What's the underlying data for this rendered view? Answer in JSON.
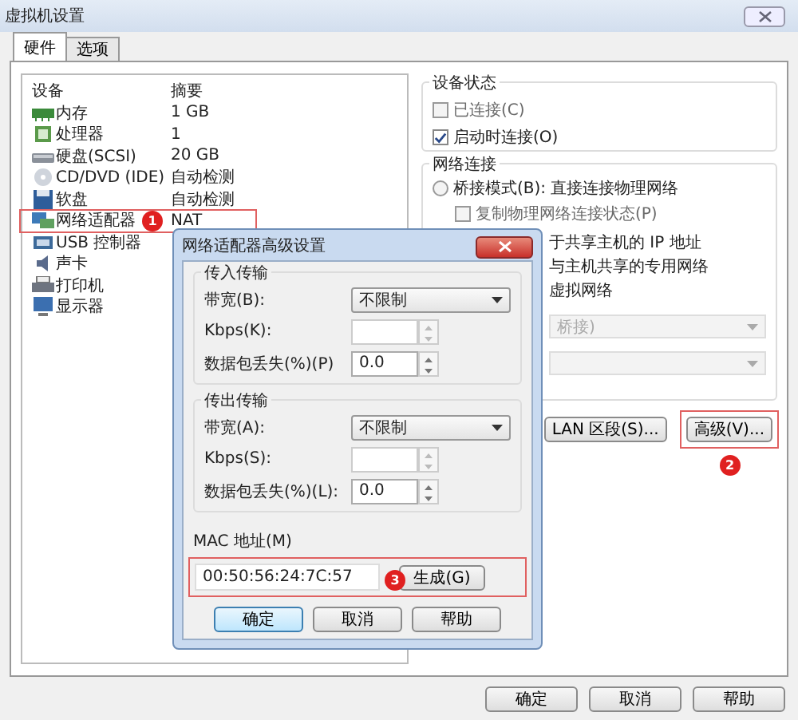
{
  "window": {
    "title": "虚拟机设置"
  },
  "tabs": [
    {
      "label": "硬件",
      "selected": true
    },
    {
      "label": "选项",
      "selected": false
    }
  ],
  "device_list": {
    "columns": [
      "设备",
      "摘要"
    ],
    "rows": [
      {
        "kind": "memory",
        "name": "内存",
        "summary": "1 GB"
      },
      {
        "kind": "cpu",
        "name": "处理器",
        "summary": "1"
      },
      {
        "kind": "disk",
        "name": "硬盘(SCSI)",
        "summary": "20 GB"
      },
      {
        "kind": "cd",
        "name": "CD/DVD (IDE)",
        "summary": "自动检测"
      },
      {
        "kind": "floppy",
        "name": "软盘",
        "summary": "自动检测"
      },
      {
        "kind": "network",
        "name": "网络适配器",
        "summary": "NAT",
        "annotation": "1"
      },
      {
        "kind": "usb",
        "name": "USB 控制器"
      },
      {
        "kind": "sound",
        "name": "声卡"
      },
      {
        "kind": "printer",
        "name": "打印机"
      },
      {
        "kind": "display",
        "name": "显示器"
      }
    ]
  },
  "device_status": {
    "title": "设备状态",
    "options": [
      {
        "label": "已连接(C)",
        "checked": false,
        "disabled": true
      },
      {
        "label": "启动时连接(O)",
        "checked": true,
        "disabled": false
      }
    ]
  },
  "network_connection": {
    "title": "网络连接",
    "bridged": {
      "label": "桥接模式(B): 直接连接物理网络",
      "selected": false
    },
    "replicate": {
      "label": "复制物理网络连接状态(P)",
      "checked": false,
      "disabled": true
    },
    "partial_lines": [
      "于共享主机的 IP 地址",
      "与主机共享的专用网络",
      "虚拟网络"
    ],
    "dropdowns": [
      {
        "value": "桥接)",
        "disabled": true
      },
      {
        "disabled": true
      }
    ]
  },
  "side_buttons": [
    {
      "label": "LAN 区段(S)..."
    },
    {
      "label": "高级(V)...",
      "annotation": "2"
    }
  ],
  "footer_buttons": [
    "确定",
    "取消",
    "帮助"
  ],
  "dialog": {
    "title": "网络适配器高级设置",
    "groups": [
      {
        "title": "传入传输",
        "bandwidth": {
          "label": "带宽(B):",
          "value": "不限制"
        },
        "kbps": {
          "label": "Kbps(K):"
        },
        "loss": {
          "label": "数据包丢失(%)(P)",
          "value": "0.0"
        }
      },
      {
        "title": "传出传输",
        "bandwidth": {
          "label": "带宽(A):",
          "value": "不限制"
        },
        "kbps": {
          "label": "Kbps(S):"
        },
        "loss": {
          "label": "数据包丢失(%)(L):",
          "value": "0.0"
        }
      }
    ],
    "mac": {
      "label": "MAC 地址(M)",
      "value": "00:50:56:24:7C:57",
      "button": "生成(G)",
      "annotation": "3"
    },
    "buttons": [
      {
        "label": "确定",
        "default": true
      },
      {
        "label": "取消",
        "default": false
      },
      {
        "label": "帮助",
        "default": false
      }
    ]
  }
}
